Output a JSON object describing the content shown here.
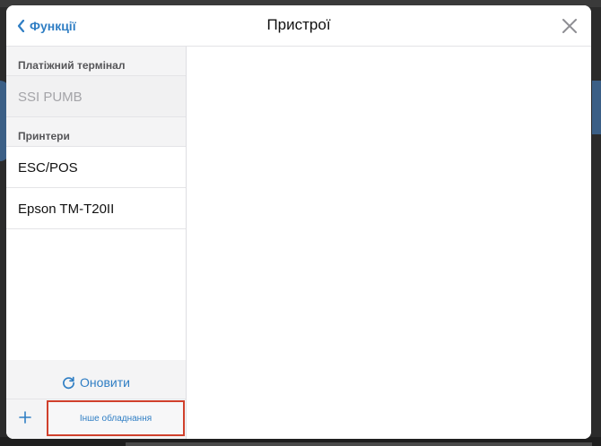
{
  "header": {
    "back_label": "Функції",
    "title": "Пристрої"
  },
  "sidebar": {
    "sections": [
      {
        "title": "Платіжний термінал",
        "items": [
          {
            "label": "SSI PUMB",
            "state": "disabled"
          }
        ]
      },
      {
        "title": "Принтери",
        "items": [
          {
            "label": "ESC/POS",
            "state": "enabled"
          },
          {
            "label": "Epson TM-T20II",
            "state": "enabled"
          }
        ]
      }
    ],
    "refresh_label": "Оновити",
    "other_hardware_label": "Інше обладнання"
  },
  "icons": {
    "back": "chevron-left-icon",
    "close": "close-icon",
    "refresh": "refresh-icon",
    "add": "plus-icon"
  },
  "colors": {
    "accent": "#2f7ec4",
    "highlight_border": "#d0402c",
    "sidebar_bg": "#f4f4f5",
    "disabled_text": "#a4a4a8"
  }
}
